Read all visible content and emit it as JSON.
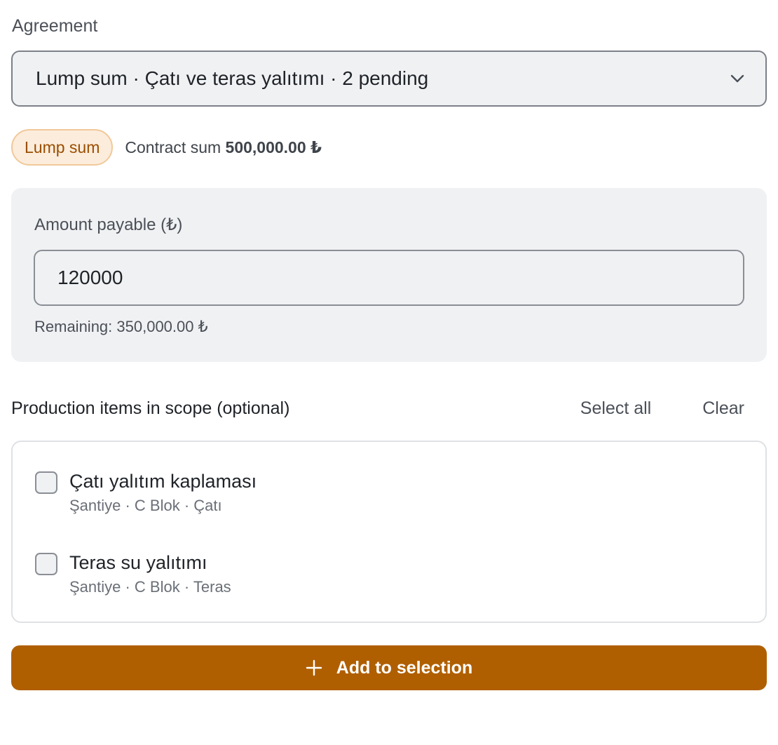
{
  "agreement": {
    "label": "Agreement",
    "selected": "Lump sum · Çatı ve teras yalıtımı · 2 pending",
    "icon": "chevron-down-icon"
  },
  "summary": {
    "badge": "Lump sum",
    "contract_sum_label": "Contract sum",
    "contract_sum_value": "500,000.00 ₺"
  },
  "payable": {
    "label": "Amount payable (₺)",
    "value": "120000",
    "remaining": "Remaining: 350,000.00 ₺"
  },
  "scope": {
    "title": "Production items in scope (optional)",
    "select_all": "Select all",
    "clear": "Clear",
    "items": [
      {
        "title": "Çatı yalıtım kaplaması",
        "subtitle": "Şantiye · C Blok · Çatı",
        "checked": false
      },
      {
        "title": "Teras su yalıtımı",
        "subtitle": "Şantiye · C Blok · Teras",
        "checked": false
      }
    ]
  },
  "action": {
    "label": "Add to selection",
    "icon": "plus-icon"
  },
  "colors": {
    "accent": "#b05f00",
    "badge_bg": "#fcecdc",
    "badge_text": "#9a4e00",
    "panel_bg": "#f0f1f3"
  }
}
